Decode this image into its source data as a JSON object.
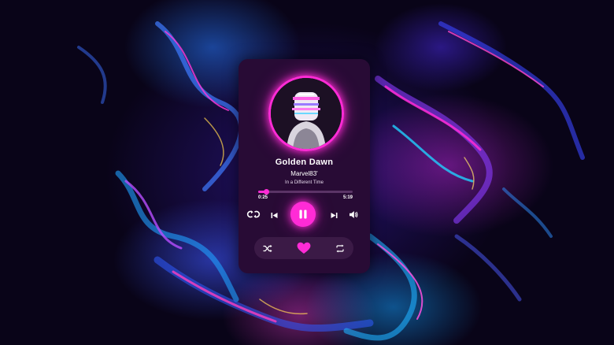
{
  "player": {
    "track_title": "Golden Dawn",
    "artist": "Marvel83'",
    "album": "In a Different Time",
    "elapsed": "0:25",
    "duration": "5:19",
    "progress_fraction": 0.08,
    "is_playing": true,
    "liked": true
  },
  "colors": {
    "accent": "#ff2bd6",
    "card_background": "#280b35",
    "pill_background": "#3b1a46"
  },
  "icons": {
    "repeat_left": "repeat-icon",
    "previous": "skip-previous-icon",
    "play_pause": "pause-icon",
    "next": "skip-next-icon",
    "volume": "volume-icon",
    "shuffle": "shuffle-icon",
    "like": "heart-icon",
    "loop": "loop-icon"
  }
}
